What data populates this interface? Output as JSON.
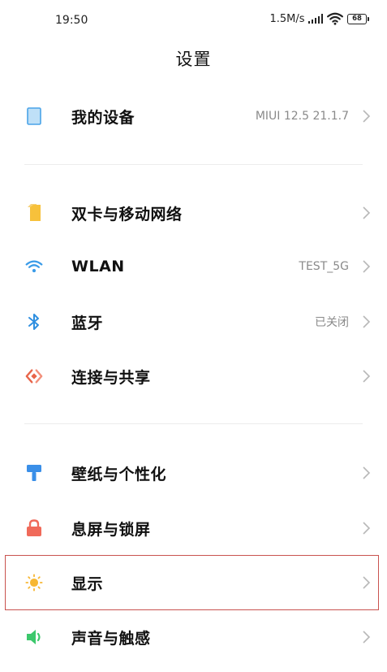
{
  "status_bar": {
    "time": "19:50",
    "net_speed": "1.5M/s",
    "battery_level": "68"
  },
  "header": {
    "title": "设置"
  },
  "sections": [
    {
      "items": [
        {
          "label": "我的设备",
          "value": "MIUI 12.5 21.1.7",
          "icon": "device-icon",
          "icon_color": "#4aa3e8"
        }
      ]
    },
    {
      "items": [
        {
          "label": "双卡与移动网络",
          "value": "",
          "icon": "sim-card-icon",
          "icon_color": "#f7c13b"
        },
        {
          "label": "WLAN",
          "value": "TEST_5G",
          "icon": "wifi-icon",
          "icon_color": "#3a9be8"
        },
        {
          "label": "蓝牙",
          "value": "已关闭",
          "icon": "bluetooth-icon",
          "icon_color": "#2f8fe0"
        },
        {
          "label": "连接与共享",
          "value": "",
          "icon": "share-icon",
          "icon_color": "#e8654a"
        }
      ]
    },
    {
      "items": [
        {
          "label": "壁纸与个性化",
          "value": "",
          "icon": "paint-brush-icon",
          "icon_color": "#3a8fe8"
        },
        {
          "label": "息屏与锁屏",
          "value": "",
          "icon": "lock-icon",
          "icon_color": "#f06a5a"
        },
        {
          "label": "显示",
          "value": "",
          "icon": "sun-icon",
          "icon_color": "#f7b733"
        },
        {
          "label": "声音与触感",
          "value": "",
          "icon": "speaker-icon",
          "icon_color": "#3cc86c"
        }
      ]
    }
  ],
  "highlight_color": "#c9534f"
}
